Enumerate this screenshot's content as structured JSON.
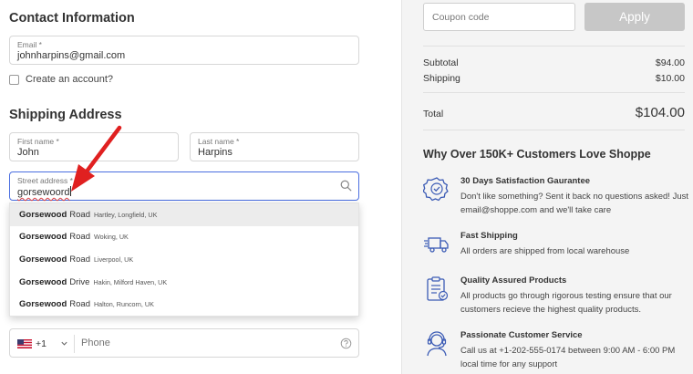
{
  "contact": {
    "title": "Contact Information",
    "email_label": "Email *",
    "email_value": "johnharpins@gmail.com",
    "create_account_label": "Create an account?"
  },
  "shipping": {
    "title": "Shipping Address",
    "first_name_label": "First name *",
    "first_name_value": "John",
    "last_name_label": "Last name *",
    "last_name_value": "Harpins",
    "street_label": "Street address *",
    "street_value": "gorsewoord",
    "suggestions": [
      {
        "name": "Gorsewood",
        "type": "Road",
        "location": "Hartley, Longfield, UK"
      },
      {
        "name": "Gorsewood",
        "type": "Road",
        "location": "Woking, UK"
      },
      {
        "name": "Gorsewood",
        "type": "Road",
        "location": "Liverpool, UK"
      },
      {
        "name": "Gorsewood",
        "type": "Drive",
        "location": "Hakin, Milford Haven, UK"
      },
      {
        "name": "Gorsewood",
        "type": "Road",
        "location": "Halton, Runcorn, UK"
      }
    ],
    "phone_country_code": "+1",
    "phone_placeholder": "Phone"
  },
  "summary": {
    "coupon_placeholder": "Coupon code",
    "apply_label": "Apply",
    "subtotal_label": "Subtotal",
    "subtotal_value": "$94.00",
    "shipping_label": "Shipping",
    "shipping_value": "$10.00",
    "total_label": "Total",
    "total_value": "$104.00"
  },
  "why": {
    "title": "Why Over 150K+ Customers Love Shoppe",
    "features": [
      {
        "icon": "badge-check-icon",
        "title": "30 Days Satisfaction Gaurantee",
        "desc": "Don't like something? Sent it back no questions asked! Just email@shoppe.com and we'll take care"
      },
      {
        "icon": "truck-icon",
        "title": "Fast Shipping",
        "desc": "All orders are shipped from local warehouse"
      },
      {
        "icon": "clipboard-check-icon",
        "title": "Quality Assured Products",
        "desc": "All products go through rigorous testing ensure that our customers recieve the highest quality products."
      },
      {
        "icon": "headset-agent-icon",
        "title": "Passionate Customer Service",
        "desc": "Call us at +1-202-555-0174 between 9:00 AM - 6:00 PM local time for any support"
      }
    ]
  },
  "colors": {
    "accent_blue": "#4a6ee0",
    "icon_blue": "#3b5bb5",
    "arrow_red": "#e02020",
    "apply_disabled": "#c7c7c7"
  }
}
